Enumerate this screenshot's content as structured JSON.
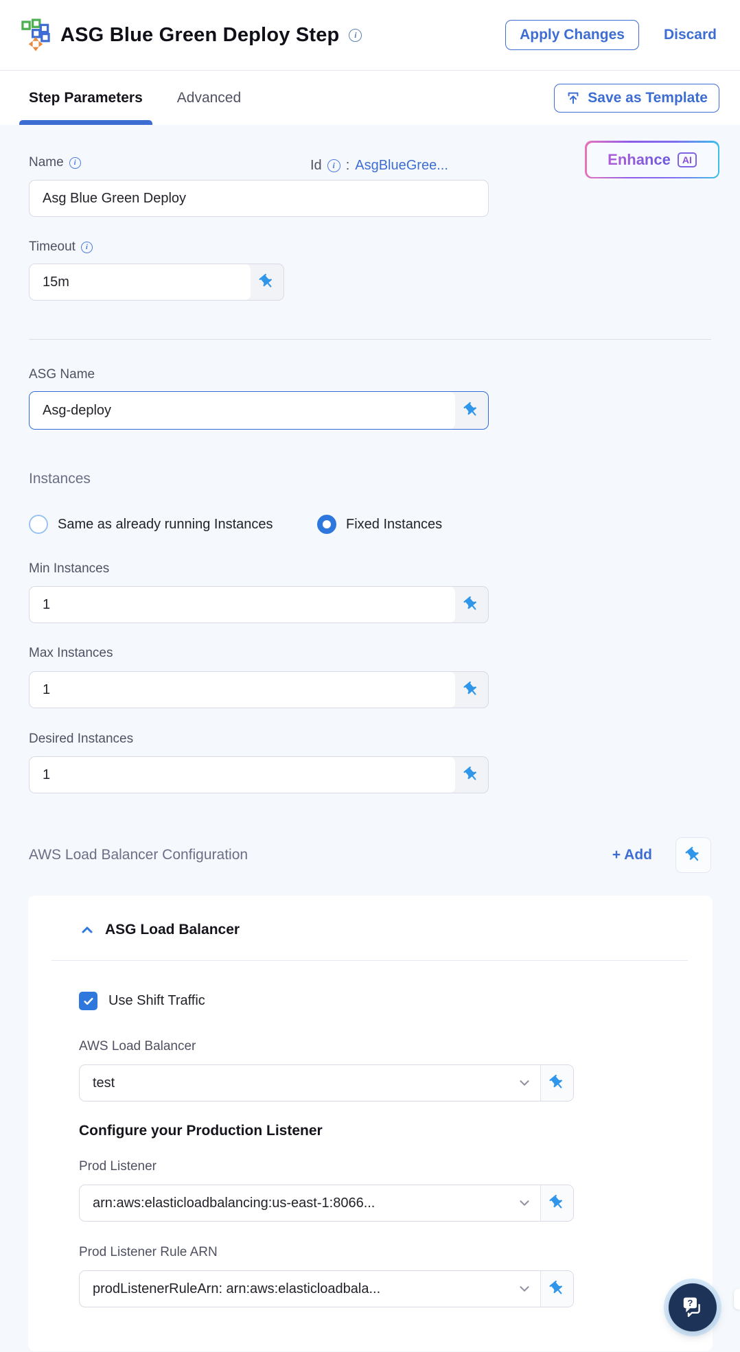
{
  "header": {
    "title": "ASG Blue Green Deploy Step",
    "apply_label": "Apply Changes",
    "discard_label": "Discard"
  },
  "tabs": {
    "step_parameters": "Step Parameters",
    "advanced": "Advanced",
    "save_as_template": "Save as Template"
  },
  "form": {
    "name": {
      "label": "Name",
      "value": "Asg Blue Green Deploy"
    },
    "id": {
      "label": "Id",
      "separator": ":",
      "value": "AsgBlueGree..."
    },
    "enhance": {
      "label": "Enhance",
      "badge": "AI"
    },
    "timeout": {
      "label": "Timeout",
      "value": "15m"
    },
    "asg_name": {
      "label": "ASG Name",
      "value": "Asg-deploy"
    },
    "instances": {
      "label": "Instances",
      "options": [
        {
          "label": "Same as already running Instances",
          "selected": false
        },
        {
          "label": "Fixed Instances",
          "selected": true
        }
      ]
    },
    "min_instances": {
      "label": "Min Instances",
      "value": "1"
    },
    "max_instances": {
      "label": "Max Instances",
      "value": "1"
    },
    "desired_instances": {
      "label": "Desired Instances",
      "value": "1"
    },
    "lb_config": {
      "label": "AWS Load Balancer Configuration",
      "add_label": "+ Add"
    },
    "lb_card": {
      "title": "ASG Load Balancer",
      "use_shift_traffic": {
        "label": "Use Shift Traffic",
        "checked": true
      },
      "aws_load_balancer": {
        "label": "AWS Load Balancer",
        "value": "test"
      },
      "prod_heading": "Configure your Production Listener",
      "prod_listener": {
        "label": "Prod Listener",
        "value": "arn:aws:elasticloadbalancing:us-east-1:8066..."
      },
      "prod_listener_rule": {
        "label": "Prod Listener Rule ARN",
        "value": "prodListenerRuleArn: arn:aws:elasticloadbala..."
      }
    }
  },
  "colors": {
    "accent_blue": "#3d6dd3",
    "control_blue": "#2e78dd",
    "pin_blue": "#2f96ea",
    "page_bg": "#f5f9fd",
    "card_bg": "#ffffff",
    "input_border": "#d9dae5",
    "label_gray": "#4f5162",
    "section_gray": "#6b6e85",
    "fab_navy": "#1d3458",
    "misspell_red": "#f4694f",
    "enhance_gradient": [
      "#e873b8",
      "#8e5ce8",
      "#39c0e8"
    ]
  },
  "icons": {
    "step_icon": "asg-blue-green-step-icon",
    "info": "info-icon",
    "pin": "pushpin-icon",
    "upload": "upload-icon",
    "chevron_down": "chevron-down-icon",
    "chevron_up": "chevron-up-icon",
    "chat": "chat-help-icon"
  }
}
